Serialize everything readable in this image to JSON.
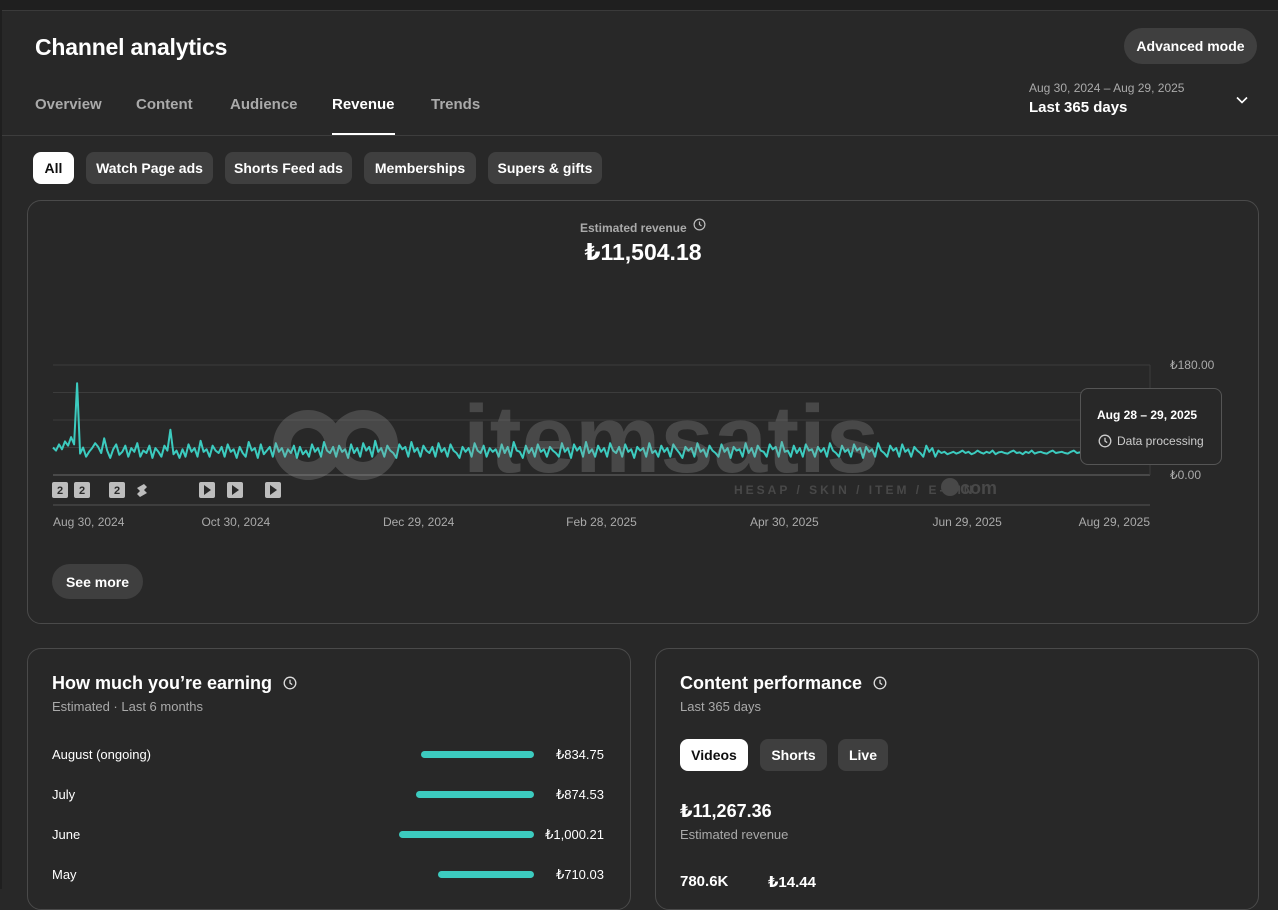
{
  "header": {
    "title": "Channel analytics",
    "advanced_mode_label": "Advanced mode",
    "date_range_sub": "Aug 30, 2024 – Aug 29, 2025",
    "date_range_main": "Last 365 days"
  },
  "tabs": [
    {
      "label": "Overview"
    },
    {
      "label": "Content"
    },
    {
      "label": "Audience"
    },
    {
      "label": "Revenue",
      "active": true
    },
    {
      "label": "Trends"
    }
  ],
  "filters": [
    {
      "label": "All",
      "active": true
    },
    {
      "label": "Watch Page ads"
    },
    {
      "label": "Shorts Feed ads"
    },
    {
      "label": "Memberships"
    },
    {
      "label": "Supers & gifts"
    }
  ],
  "revenue_card": {
    "label": "Estimated revenue",
    "value": "₺11,504.18",
    "see_more_label": "See more",
    "tooltip": {
      "date": "Aug 28 – 29, 2025",
      "status": "Data processing"
    }
  },
  "chart_data": {
    "type": "line",
    "title": "",
    "x_tick_labels": [
      "Aug 30, 2024",
      "Oct 30, 2024",
      "Dec 29, 2024",
      "Feb 28, 2025",
      "Apr 30, 2025",
      "Jun 29, 2025",
      "Aug 29, 2025"
    ],
    "y_tick_labels": [
      "₺180.00",
      "₺0.00"
    ],
    "ylim": [
      0,
      180
    ],
    "ylabel": "",
    "xlabel": "",
    "series": [
      {
        "color": "#3ccbbf",
        "values": [
          45,
          40,
          50,
          42,
          55,
          48,
          62,
          50,
          150,
          35,
          45,
          30,
          38,
          44,
          52,
          46,
          36,
          60,
          40,
          28,
          42,
          50,
          33,
          38,
          48,
          30,
          44,
          38,
          52,
          30,
          40,
          36,
          48,
          28,
          44,
          38,
          30,
          48,
          40,
          74,
          34,
          40,
          28,
          42,
          30,
          50,
          38,
          44,
          30,
          56,
          38,
          42,
          30,
          48,
          40,
          36,
          46,
          30,
          50,
          38,
          42,
          28,
          46,
          36,
          30,
          54,
          40,
          44,
          28,
          50,
          34,
          40,
          46,
          30,
          52,
          38,
          44,
          30,
          42,
          36,
          48,
          28,
          46,
          34,
          40,
          30,
          50,
          38,
          44,
          30,
          54,
          40,
          36,
          46,
          30,
          48,
          38,
          42,
          28,
          50,
          36,
          44,
          30,
          52,
          40,
          46,
          30,
          56,
          38,
          44,
          30,
          48,
          40,
          36,
          28,
          50,
          42,
          46,
          30,
          54,
          38,
          44,
          30,
          48,
          40,
          36,
          46,
          30,
          52,
          38,
          44,
          30,
          50,
          40,
          36,
          28,
          46,
          38,
          44,
          30,
          52,
          40,
          36,
          48,
          30,
          44,
          38,
          42,
          30,
          50,
          36,
          46,
          30,
          54,
          40,
          38,
          28,
          48,
          36,
          44,
          30,
          50,
          38,
          42,
          30,
          46,
          40,
          36,
          30,
          52,
          38,
          44,
          28,
          50,
          40,
          46,
          30,
          54,
          36,
          42,
          30,
          48,
          38,
          44,
          30,
          52,
          40,
          36,
          46,
          30,
          50,
          38,
          42,
          28,
          46,
          40,
          44,
          30,
          52,
          36,
          40,
          30,
          48,
          38,
          44,
          30,
          50,
          42,
          36,
          28,
          46,
          40,
          44,
          30,
          52,
          38,
          42,
          30,
          48,
          40,
          36,
          30,
          50,
          38,
          44,
          28,
          46,
          40,
          42,
          30,
          52,
          36,
          44,
          30,
          48,
          40,
          38,
          30,
          50,
          42,
          46,
          30,
          54,
          38,
          40,
          30,
          48,
          36,
          44,
          30,
          50,
          40,
          42,
          30,
          46,
          38,
          44,
          30,
          52,
          40,
          36,
          30,
          48,
          38,
          42,
          30,
          50,
          40,
          44,
          28,
          46,
          38,
          42,
          30,
          52,
          40,
          36,
          30,
          48,
          40,
          44,
          30,
          50,
          38,
          42,
          30,
          46,
          40,
          36,
          30,
          48,
          38,
          44,
          30,
          40,
          36,
          38,
          34,
          36,
          38,
          35,
          37,
          40,
          36,
          38,
          34,
          36,
          40,
          37,
          35,
          38,
          36,
          40,
          34,
          37,
          38,
          36,
          35,
          38,
          40,
          36,
          37,
          34,
          38,
          36,
          40,
          35,
          37,
          38,
          36,
          35,
          38,
          40,
          36,
          37,
          38,
          36,
          35,
          38,
          40,
          36,
          37,
          38,
          36,
          38,
          40,
          37,
          36,
          38,
          40,
          36,
          38
        ]
      }
    ],
    "grid": true,
    "content_markers": [
      "2",
      "2",
      "2",
      "shorts",
      "play",
      "play",
      "play"
    ]
  },
  "earning_card": {
    "title": "How much you’re earning",
    "subtitle": "Estimated · Last 6 months",
    "rows": [
      {
        "label": "August (ongoing)",
        "value": "₺834.75",
        "amount": 834.75
      },
      {
        "label": "July",
        "value": "₺874.53",
        "amount": 874.53
      },
      {
        "label": "June",
        "value": "₺1,000.21",
        "amount": 1000.21
      },
      {
        "label": "May",
        "value": "₺710.03",
        "amount": 710.03
      }
    ]
  },
  "content_card": {
    "title": "Content performance",
    "subtitle": "Last 365 days",
    "tabs": [
      {
        "label": "Videos",
        "active": true
      },
      {
        "label": "Shorts"
      },
      {
        "label": "Live"
      }
    ],
    "value": "₺11,267.36",
    "value_label": "Estimated revenue",
    "mini_values": [
      "780.6K",
      "₺14.44"
    ]
  },
  "watermark": {
    "brand": "itemsatis",
    "tagline": "HESAP / SKIN / ITEM / E-PIN",
    "suffix": "com"
  },
  "colors": {
    "background": "#282828",
    "accent": "#3ccbbf"
  }
}
